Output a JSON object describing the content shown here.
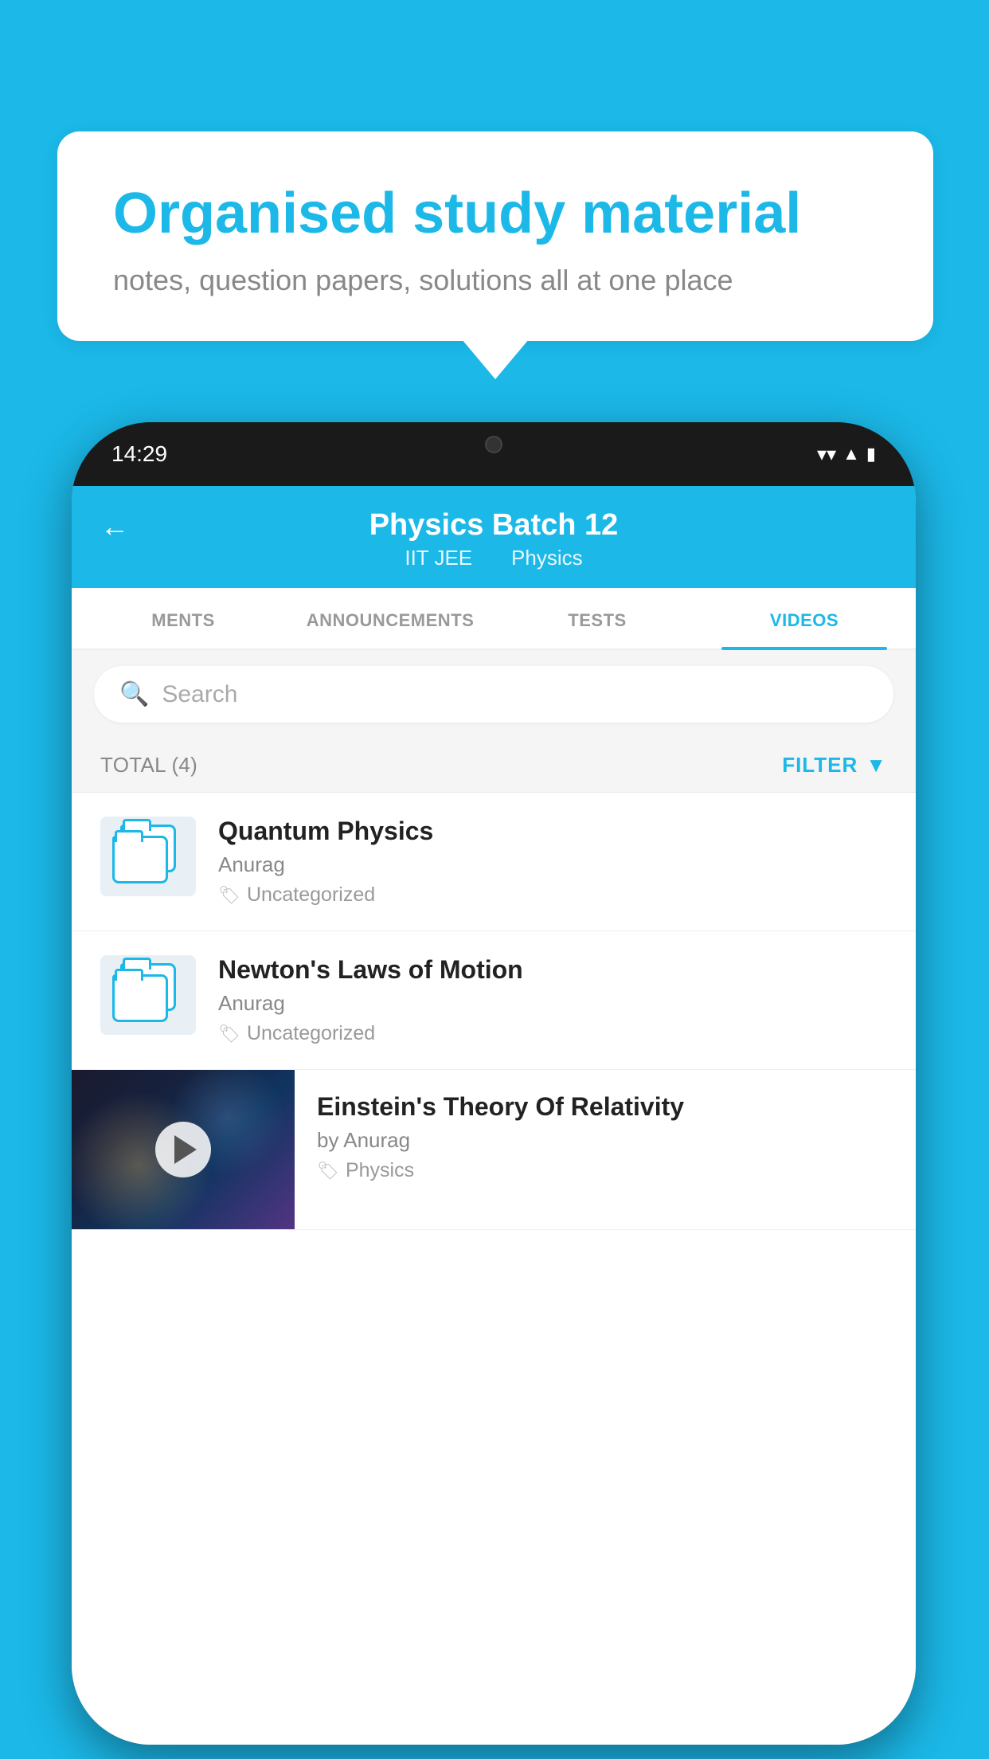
{
  "background_color": "#1bb8e8",
  "speech_bubble": {
    "title": "Organised study material",
    "subtitle": "notes, question papers, solutions all at one place"
  },
  "phone": {
    "status_bar": {
      "time": "14:29"
    },
    "header": {
      "back_label": "←",
      "title": "Physics Batch 12",
      "subtitle_part1": "IIT JEE",
      "subtitle_part2": "Physics"
    },
    "tabs": [
      {
        "label": "MENTS",
        "active": false
      },
      {
        "label": "ANNOUNCEMENTS",
        "active": false
      },
      {
        "label": "TESTS",
        "active": false
      },
      {
        "label": "VIDEOS",
        "active": true
      }
    ],
    "search": {
      "placeholder": "Search"
    },
    "total_filter": {
      "total_label": "TOTAL (4)",
      "filter_label": "FILTER"
    },
    "videos": [
      {
        "title": "Quantum Physics",
        "author": "Anurag",
        "tag": "Uncategorized",
        "type": "folder"
      },
      {
        "title": "Newton's Laws of Motion",
        "author": "Anurag",
        "tag": "Uncategorized",
        "type": "folder"
      },
      {
        "title": "Einstein's Theory Of Relativity",
        "author": "by Anurag",
        "tag": "Physics",
        "type": "video"
      }
    ]
  }
}
